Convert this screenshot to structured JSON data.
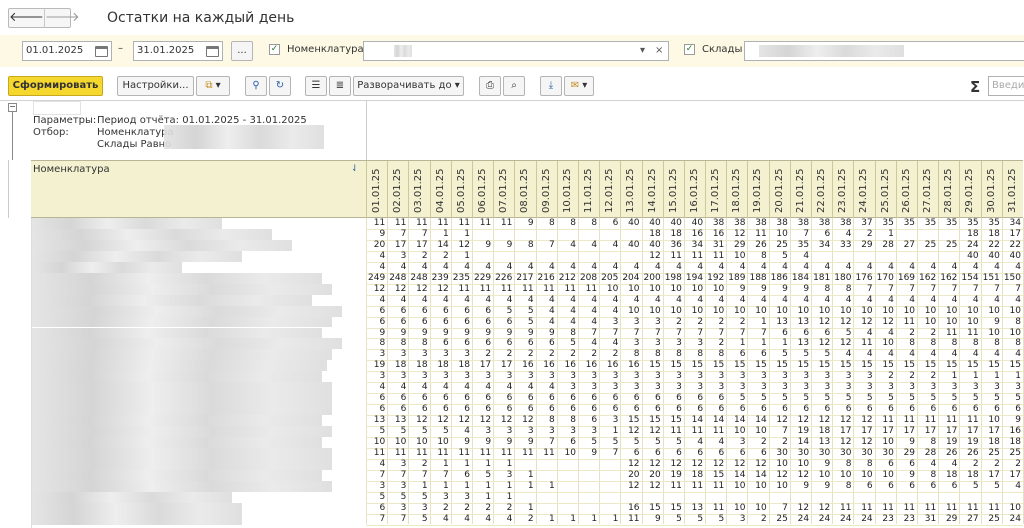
{
  "window": {
    "title": "Остатки на каждый день"
  },
  "nav": {
    "back": "🡐",
    "forward": "🡒"
  },
  "filters": {
    "date_from": "01.01.2025",
    "dash": "–",
    "date_to": "31.01.2025",
    "more": "...",
    "nomenclature_label": "Номенклатура:",
    "nomenclature_checked": true,
    "warehouses_label": "Склады",
    "warehouses_checked": true,
    "dropdown_glyph": "▾",
    "clear_glyph": "×"
  },
  "toolbar": {
    "generate": "Сформировать",
    "settings": "Настройки...",
    "expand": "Разворачивать до",
    "sigma": "Σ",
    "search_placeholder": "Введи"
  },
  "params": {
    "params_label": "Параметры:",
    "period": "Период отчёта: 01.01.2025 - 31.01.2025",
    "filter_label": "Отбор:",
    "filter_nom": "Номенклатура",
    "filter_wh": "Склады Равно"
  },
  "table": {
    "column_header": "Номенклатура",
    "sort_glyph": "⇃",
    "dates": [
      "01.01.25",
      "02.01.25",
      "03.01.25",
      "04.01.25",
      "05.01.25",
      "06.01.25",
      "07.01.25",
      "08.01.25",
      "09.01.25",
      "10.01.25",
      "11.01.25",
      "12.01.25",
      "13.01.25",
      "14.01.25",
      "15.01.25",
      "16.01.25",
      "17.01.25",
      "18.01.25",
      "19.01.25",
      "20.01.25",
      "21.01.25",
      "22.01.25",
      "23.01.25",
      "24.01.25",
      "25.01.25",
      "26.01.25",
      "27.01.25",
      "28.01.25",
      "29.01.25",
      "30.01.25",
      "31.01.25"
    ],
    "rows": [
      [
        "11",
        "11",
        "11",
        "11",
        "11",
        "11",
        "11",
        "9",
        "8",
        "8",
        "8",
        "6",
        "40",
        "40",
        "40",
        "40",
        "38",
        "38",
        "38",
        "38",
        "38",
        "38",
        "38",
        "37",
        "35",
        "35",
        "35",
        "35",
        "35",
        "35",
        "34"
      ],
      [
        "9",
        "7",
        "7",
        "1",
        "1",
        "",
        "",
        "",
        "",
        "",
        "",
        "",
        "",
        "18",
        "18",
        "16",
        "16",
        "12",
        "11",
        "10",
        "7",
        "6",
        "4",
        "2",
        "1",
        "",
        "",
        "",
        "18",
        "18",
        "17"
      ],
      [
        "20",
        "17",
        "17",
        "14",
        "12",
        "9",
        "9",
        "8",
        "7",
        "4",
        "4",
        "4",
        "40",
        "40",
        "36",
        "34",
        "31",
        "29",
        "26",
        "25",
        "35",
        "34",
        "33",
        "29",
        "28",
        "27",
        "25",
        "25",
        "24",
        "22",
        "22"
      ],
      [
        "4",
        "3",
        "2",
        "2",
        "1",
        "",
        "",
        "",
        "",
        "",
        "",
        "",
        "",
        "12",
        "11",
        "11",
        "11",
        "10",
        "8",
        "5",
        "4",
        "",
        "",
        "",
        "",
        "",
        "",
        "",
        "40",
        "40",
        "40"
      ],
      [
        "4",
        "4",
        "4",
        "4",
        "4",
        "4",
        "4",
        "4",
        "4",
        "4",
        "4",
        "4",
        "4",
        "4",
        "4",
        "4",
        "4",
        "4",
        "4",
        "4",
        "4",
        "4",
        "4",
        "4",
        "4",
        "4",
        "4",
        "4",
        "4",
        "4",
        "4"
      ],
      [
        "249",
        "248",
        "248",
        "239",
        "235",
        "229",
        "226",
        "217",
        "216",
        "212",
        "208",
        "205",
        "204",
        "200",
        "198",
        "194",
        "192",
        "189",
        "188",
        "186",
        "184",
        "181",
        "180",
        "176",
        "170",
        "169",
        "162",
        "162",
        "154",
        "151",
        "150"
      ],
      [
        "12",
        "12",
        "12",
        "12",
        "11",
        "11",
        "11",
        "11",
        "11",
        "11",
        "11",
        "10",
        "10",
        "10",
        "10",
        "10",
        "10",
        "9",
        "9",
        "9",
        "9",
        "8",
        "8",
        "7",
        "7",
        "7",
        "7",
        "7",
        "7",
        "7",
        "7"
      ],
      [
        "4",
        "4",
        "4",
        "4",
        "4",
        "4",
        "4",
        "4",
        "4",
        "4",
        "4",
        "4",
        "4",
        "4",
        "4",
        "4",
        "4",
        "4",
        "4",
        "4",
        "4",
        "4",
        "4",
        "4",
        "4",
        "4",
        "4",
        "4",
        "4",
        "4",
        "4"
      ],
      [
        "6",
        "6",
        "6",
        "6",
        "6",
        "6",
        "5",
        "5",
        "4",
        "4",
        "4",
        "4",
        "10",
        "10",
        "10",
        "10",
        "10",
        "10",
        "10",
        "10",
        "10",
        "10",
        "10",
        "10",
        "10",
        "10",
        "10",
        "10",
        "10",
        "10",
        "10"
      ],
      [
        "6",
        "6",
        "6",
        "6",
        "6",
        "6",
        "6",
        "5",
        "4",
        "4",
        "4",
        "3",
        "3",
        "3",
        "2",
        "2",
        "2",
        "2",
        "1",
        "13",
        "13",
        "12",
        "12",
        "12",
        "12",
        "11",
        "10",
        "10",
        "10",
        "9",
        "8"
      ],
      [
        "9",
        "9",
        "9",
        "9",
        "9",
        "9",
        "9",
        "9",
        "9",
        "8",
        "7",
        "7",
        "7",
        "7",
        "7",
        "7",
        "7",
        "7",
        "7",
        "6",
        "6",
        "6",
        "5",
        "4",
        "4",
        "2",
        "2",
        "11",
        "11",
        "10",
        "10"
      ],
      [
        "8",
        "8",
        "8",
        "6",
        "6",
        "6",
        "6",
        "6",
        "6",
        "5",
        "4",
        "4",
        "3",
        "3",
        "3",
        "3",
        "2",
        "1",
        "1",
        "1",
        "13",
        "12",
        "12",
        "11",
        "10",
        "8",
        "8",
        "8",
        "8",
        "8",
        "8"
      ],
      [
        "3",
        "3",
        "3",
        "3",
        "3",
        "2",
        "2",
        "2",
        "2",
        "2",
        "2",
        "2",
        "8",
        "8",
        "8",
        "8",
        "8",
        "6",
        "6",
        "5",
        "5",
        "5",
        "4",
        "4",
        "4",
        "4",
        "4",
        "4",
        "4",
        "4",
        "4"
      ],
      [
        "19",
        "18",
        "18",
        "18",
        "18",
        "17",
        "17",
        "16",
        "16",
        "16",
        "16",
        "16",
        "16",
        "15",
        "15",
        "15",
        "15",
        "15",
        "15",
        "15",
        "15",
        "15",
        "15",
        "15",
        "15",
        "15",
        "15",
        "15",
        "15",
        "15",
        "15"
      ],
      [
        "3",
        "3",
        "3",
        "3",
        "3",
        "3",
        "3",
        "3",
        "3",
        "3",
        "3",
        "3",
        "3",
        "3",
        "3",
        "3",
        "3",
        "3",
        "3",
        "3",
        "3",
        "3",
        "3",
        "3",
        "2",
        "2",
        "2",
        "1",
        "1",
        "1",
        "1"
      ],
      [
        "4",
        "4",
        "4",
        "4",
        "4",
        "4",
        "4",
        "4",
        "4",
        "3",
        "3",
        "3",
        "3",
        "3",
        "3",
        "3",
        "3",
        "3",
        "3",
        "3",
        "3",
        "3",
        "3",
        "3",
        "3",
        "3",
        "3",
        "3",
        "3",
        "3",
        "3"
      ],
      [
        "6",
        "6",
        "6",
        "6",
        "6",
        "6",
        "6",
        "6",
        "6",
        "6",
        "6",
        "6",
        "6",
        "6",
        "6",
        "6",
        "6",
        "5",
        "5",
        "5",
        "5",
        "5",
        "5",
        "5",
        "5",
        "5",
        "5",
        "5",
        "5",
        "5",
        "5"
      ],
      [
        "6",
        "6",
        "6",
        "6",
        "6",
        "6",
        "6",
        "6",
        "6",
        "6",
        "6",
        "6",
        "6",
        "6",
        "6",
        "6",
        "6",
        "6",
        "6",
        "6",
        "6",
        "6",
        "6",
        "6",
        "6",
        "6",
        "6",
        "6",
        "6",
        "6",
        "6"
      ],
      [
        "13",
        "13",
        "12",
        "12",
        "12",
        "12",
        "12",
        "12",
        "8",
        "8",
        "6",
        "3",
        "15",
        "15",
        "15",
        "14",
        "14",
        "14",
        "14",
        "12",
        "12",
        "12",
        "12",
        "12",
        "11",
        "11",
        "11",
        "11",
        "11",
        "10",
        "9"
      ],
      [
        "5",
        "5",
        "5",
        "5",
        "4",
        "3",
        "3",
        "3",
        "3",
        "3",
        "3",
        "1",
        "12",
        "12",
        "11",
        "11",
        "11",
        "10",
        "10",
        "7",
        "19",
        "18",
        "17",
        "17",
        "17",
        "17",
        "17",
        "17",
        "17",
        "17",
        "16"
      ],
      [
        "10",
        "10",
        "10",
        "10",
        "9",
        "9",
        "9",
        "9",
        "7",
        "6",
        "5",
        "5",
        "5",
        "5",
        "5",
        "4",
        "4",
        "3",
        "2",
        "2",
        "14",
        "13",
        "12",
        "12",
        "10",
        "9",
        "8",
        "19",
        "19",
        "18",
        "18"
      ],
      [
        "11",
        "11",
        "11",
        "11",
        "11",
        "11",
        "11",
        "11",
        "11",
        "10",
        "9",
        "7",
        "6",
        "6",
        "6",
        "6",
        "6",
        "6",
        "6",
        "30",
        "30",
        "30",
        "30",
        "30",
        "30",
        "29",
        "28",
        "26",
        "26",
        "25",
        "25"
      ],
      [
        "4",
        "3",
        "2",
        "1",
        "1",
        "1",
        "1",
        "",
        "",
        "",
        "",
        "",
        "12",
        "12",
        "12",
        "12",
        "12",
        "12",
        "12",
        "10",
        "10",
        "9",
        "8",
        "8",
        "6",
        "6",
        "4",
        "4",
        "2",
        "2",
        "2"
      ],
      [
        "7",
        "7",
        "7",
        "7",
        "6",
        "5",
        "3",
        "1",
        "",
        "",
        "",
        "",
        "20",
        "20",
        "19",
        "18",
        "15",
        "14",
        "14",
        "12",
        "12",
        "10",
        "10",
        "10",
        "10",
        "9",
        "8",
        "18",
        "18",
        "17",
        "17"
      ],
      [
        "3",
        "3",
        "1",
        "1",
        "1",
        "1",
        "1",
        "1",
        "1",
        "",
        "",
        "",
        "12",
        "12",
        "11",
        "11",
        "11",
        "10",
        "10",
        "10",
        "9",
        "9",
        "8",
        "6",
        "6",
        "6",
        "6",
        "6",
        "5",
        "5",
        "4"
      ],
      [
        "5",
        "5",
        "5",
        "3",
        "3",
        "1",
        "1",
        "",
        "",
        "",
        "",
        "",
        "",
        "",
        "",
        "",
        "",
        "",
        "",
        "",
        "",
        "",
        "",
        "",
        "",
        "",
        "",
        "",
        "",
        "",
        ""
      ],
      [
        "6",
        "3",
        "3",
        "2",
        "2",
        "2",
        "2",
        "1",
        "",
        "",
        "",
        "",
        "16",
        "15",
        "15",
        "13",
        "11",
        "10",
        "10",
        "7",
        "12",
        "12",
        "11",
        "11",
        "11",
        "11",
        "11",
        "11",
        "11",
        "11",
        "10"
      ],
      [
        "7",
        "7",
        "5",
        "4",
        "4",
        "4",
        "4",
        "2",
        "1",
        "1",
        "1",
        "1",
        "11",
        "9",
        "5",
        "5",
        "5",
        "3",
        "2",
        "25",
        "24",
        "24",
        "24",
        "24",
        "23",
        "23",
        "31",
        "29",
        "27",
        "25",
        "24"
      ]
    ]
  }
}
